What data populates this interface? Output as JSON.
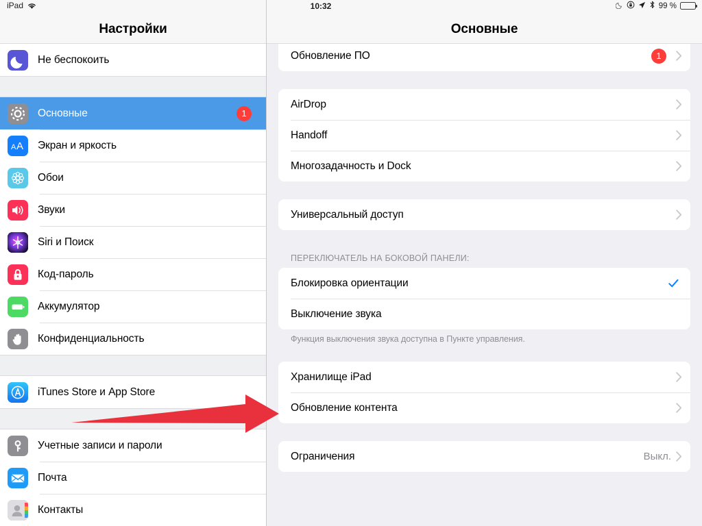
{
  "status_bar": {
    "device_label": "iPad",
    "wifi_icon": "wifi-icon",
    "time": "10:32",
    "do_not_disturb_icon": "moon-icon",
    "orientation_lock_icon": "rotation-lock-icon",
    "location_icon": "location-arrow-icon",
    "bluetooth_icon": "bluetooth-icon",
    "battery_percent": "99 %",
    "battery_icon": "battery-full-icon"
  },
  "sidebar": {
    "title": "Настройки",
    "groups": [
      {
        "items": [
          {
            "label": "Не беспокоить",
            "icon": "moon-icon",
            "icon_color": "#5856d6",
            "selected": false,
            "badge": null
          }
        ]
      },
      {
        "items": [
          {
            "label": "Основные",
            "icon": "gear-icon",
            "icon_color": "#8e8e93",
            "selected": true,
            "badge": "1"
          },
          {
            "label": "Экран и яркость",
            "icon": "text-size-icon",
            "icon_color": "#147efb",
            "selected": false,
            "badge": null
          },
          {
            "label": "Обои",
            "icon": "flower-icon",
            "icon_color": "#5ac8e8",
            "selected": false,
            "badge": null
          },
          {
            "label": "Звуки",
            "icon": "speaker-icon",
            "icon_color": "#fc3158",
            "selected": false,
            "badge": null
          },
          {
            "label": "Siri и Поиск",
            "icon": "siri-icon",
            "icon_color": "#2b1a4a",
            "selected": false,
            "badge": null
          },
          {
            "label": "Код-пароль",
            "icon": "lock-icon",
            "icon_color": "#fc3158",
            "selected": false,
            "badge": null
          },
          {
            "label": "Аккумулятор",
            "icon": "battery-icon",
            "icon_color": "#4cd964",
            "selected": false,
            "badge": null
          },
          {
            "label": "Конфиденциальность",
            "icon": "hand-icon",
            "icon_color": "#8e8e93",
            "selected": false,
            "badge": null
          }
        ]
      },
      {
        "items": [
          {
            "label": "iTunes Store и App Store",
            "icon": "app-store-icon",
            "icon_color": "#26b3f7",
            "selected": false,
            "badge": null
          }
        ]
      },
      {
        "items": [
          {
            "label": "Учетные записи и пароли",
            "icon": "key-icon",
            "icon_color": "#8e8e93",
            "selected": false,
            "badge": null
          },
          {
            "label": "Почта",
            "icon": "mail-icon",
            "icon_color": "#1d9bf7",
            "selected": false,
            "badge": null
          },
          {
            "label": "Контакты",
            "icon": "contacts-icon",
            "icon_color": "#b0b0b4",
            "selected": false,
            "badge": null
          }
        ]
      }
    ]
  },
  "detail": {
    "title": "Основные",
    "sections": [
      {
        "id": "software-update",
        "clipped_top": true,
        "rows": [
          {
            "label": "Обновление ПО",
            "value": null,
            "badge": "1",
            "chevron": true,
            "check": false
          }
        ]
      },
      {
        "id": "sharing",
        "rows": [
          {
            "label": "AirDrop",
            "value": null,
            "badge": null,
            "chevron": true,
            "check": false
          },
          {
            "label": "Handoff",
            "value": null,
            "badge": null,
            "chevron": true,
            "check": false
          },
          {
            "label": "Многозадачность и Dock",
            "value": null,
            "badge": null,
            "chevron": true,
            "check": false
          }
        ]
      },
      {
        "id": "accessibility",
        "rows": [
          {
            "label": "Универсальный доступ",
            "value": null,
            "badge": null,
            "chevron": true,
            "check": false
          }
        ]
      },
      {
        "id": "side-switch",
        "header": "ПЕРЕКЛЮЧАТЕЛЬ НА БОКОВОЙ ПАНЕЛИ:",
        "footer": "Функция выключения звука доступна в Пункте управления.",
        "rows": [
          {
            "label": "Блокировка ориентации",
            "value": null,
            "badge": null,
            "chevron": false,
            "check": true
          },
          {
            "label": "Выключение звука",
            "value": null,
            "badge": null,
            "chevron": false,
            "check": false
          }
        ]
      },
      {
        "id": "storage",
        "rows": [
          {
            "label": "Хранилище iPad",
            "value": null,
            "badge": null,
            "chevron": true,
            "check": false
          },
          {
            "label": "Обновление контента",
            "value": null,
            "badge": null,
            "chevron": true,
            "check": false
          }
        ]
      },
      {
        "id": "restrictions",
        "rows": [
          {
            "label": "Ограничения",
            "value": "Выкл.",
            "badge": null,
            "chevron": true,
            "check": false
          }
        ]
      }
    ]
  },
  "annotation": {
    "arrow_icon": "red-arrow-right-icon",
    "arrow_color": "#e8313c"
  },
  "colors": {
    "selection_blue": "#4a9ae8",
    "badge_red": "#fc3d39",
    "accent_check": "#0a84ff",
    "page_background": "#efeff4",
    "card_background": "#ffffff",
    "secondary_text": "#8e8e93"
  }
}
